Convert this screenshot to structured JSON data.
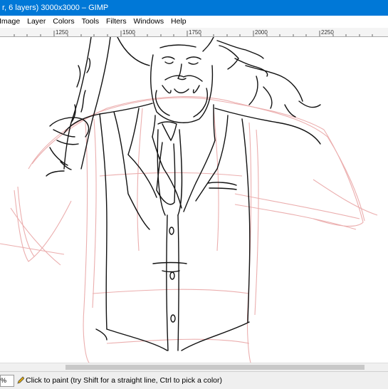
{
  "window": {
    "title": "r, 6 layers) 3000x3000 – GIMP"
  },
  "menu": [
    "Image",
    "Layer",
    "Colors",
    "Tools",
    "Filters",
    "Windows",
    "Help"
  ],
  "ruler": {
    "labels": [
      "1250",
      "1500",
      "1750",
      "2000",
      "2250"
    ]
  },
  "status": {
    "zoom": "% ",
    "message": "Click to paint (try Shift for a straight line, Ctrl to pick a color)"
  },
  "icons": {
    "pencil": "pencil-icon",
    "zoom_dropdown": "chevron-down-icon"
  }
}
